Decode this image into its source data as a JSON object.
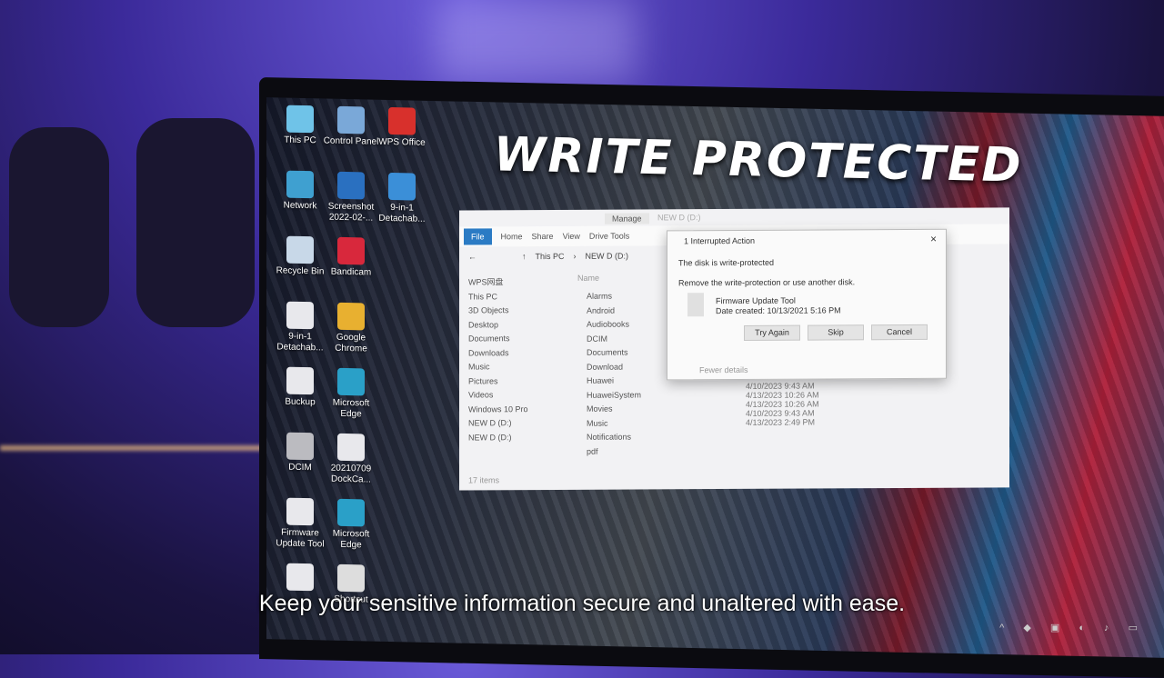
{
  "overlay": {
    "title": "WRITE PROTECTED",
    "caption": "Keep your sensitive information secure and unaltered with ease."
  },
  "desktop_icons": [
    {
      "label": "This PC",
      "icon": "computer-icon",
      "color": "#6fc3e8"
    },
    {
      "label": "Control Panel",
      "icon": "control-panel-icon",
      "color": "#7aa8d8"
    },
    {
      "label": "WPS Office",
      "icon": "wps-icon",
      "color": "#d8302c"
    },
    {
      "label": "Network",
      "icon": "network-icon",
      "color": "#3fa0d0"
    },
    {
      "label": "Screenshot 2022-02-...",
      "icon": "image-icon",
      "color": "#2a70c0"
    },
    {
      "label": "9-in-1 Detachab...",
      "icon": "zip-icon",
      "color": "#3b8fd8"
    },
    {
      "label": "Recycle Bin",
      "icon": "recycle-bin-icon",
      "color": "#c8d8e8"
    },
    {
      "label": "Bandicam",
      "icon": "bandicam-icon",
      "color": "#d8283c"
    },
    {
      "label": "9-in-1 Detachab...",
      "icon": "file-icon",
      "color": "#e8e8ec"
    },
    {
      "label": "Google Chrome",
      "icon": "chrome-icon",
      "color": "#e8b030"
    },
    {
      "label": "Buckup",
      "icon": "file-icon",
      "color": "#e8e8ec"
    },
    {
      "label": "Microsoft Edge",
      "icon": "edge-icon",
      "color": "#2aa0c8"
    },
    {
      "label": "DCIM",
      "icon": "file-icon",
      "color": "#bbbbc0"
    },
    {
      "label": "20210709 DockCa...",
      "icon": "file-icon",
      "color": "#e8e8ec"
    },
    {
      "label": "Firmware Update Tool",
      "icon": "file-icon",
      "color": "#e8e8ec"
    },
    {
      "label": "Microsoft Edge",
      "icon": "edge-icon",
      "color": "#2aa0c8"
    },
    {
      "label": "",
      "icon": "file-icon",
      "color": "#e8e8ec"
    },
    {
      "label": "Shortcut",
      "icon": "obs-icon",
      "color": "#dddddd"
    }
  ],
  "explorer": {
    "manage": "Manage",
    "window_title": "NEW D (D:)",
    "tabs": [
      "File",
      "Home",
      "Share",
      "View",
      "Drive Tools"
    ],
    "path": [
      "This PC",
      "NEW D (D:)"
    ],
    "column_name": "Name",
    "nav": [
      "WPS网盘",
      "This PC",
      "3D Objects",
      "Desktop",
      "Documents",
      "Downloads",
      "Music",
      "Pictures",
      "Videos",
      "Windows 10 Pro",
      "NEW D (D:)",
      "NEW D (D:)"
    ],
    "files": [
      "Alarms",
      "Android",
      "Audiobooks",
      "DCIM",
      "Documents",
      "Download",
      "Huawei",
      "HuaweiSystem",
      "Movies",
      "Music",
      "Notifications",
      "pdf"
    ],
    "dates": [
      "4/10/2023 9:43 AM",
      "4/13/2023 10:26 AM",
      "4/13/2023 10:26 AM",
      "4/10/2023 9:43 AM",
      "4/13/2023 2:49 PM"
    ],
    "status": "17 items"
  },
  "dialog": {
    "title": "1 Interrupted Action",
    "message": "The disk is write-protected",
    "instruction": "Remove the write-protection or use another disk.",
    "file_name": "Firmware Update Tool",
    "file_date": "Date created: 10/13/2021 5:16 PM",
    "buttons": [
      "Try Again",
      "Skip",
      "Cancel"
    ],
    "details": "Fewer details"
  }
}
